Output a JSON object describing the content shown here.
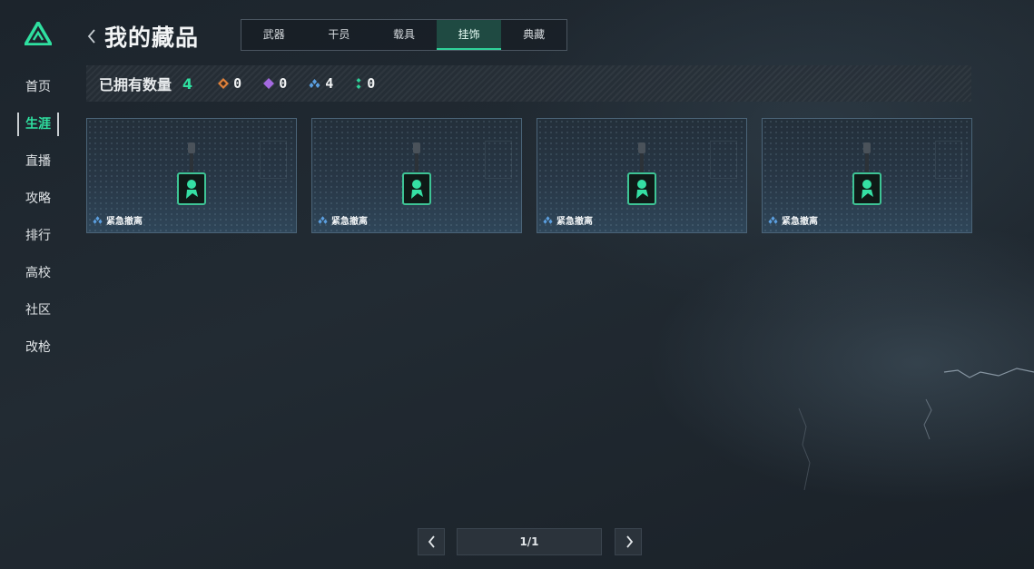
{
  "sidebar": {
    "items": [
      {
        "label": "首页"
      },
      {
        "label": "生涯"
      },
      {
        "label": "直播"
      },
      {
        "label": "攻略"
      },
      {
        "label": "排行"
      },
      {
        "label": "高校"
      },
      {
        "label": "社区"
      },
      {
        "label": "改枪"
      }
    ],
    "active_index": 1,
    "accent_color": "#2fe0a0"
  },
  "header": {
    "title": "我的藏品",
    "tabs": [
      {
        "label": "武器"
      },
      {
        "label": "干员"
      },
      {
        "label": "载具"
      },
      {
        "label": "挂饰"
      },
      {
        "label": "典藏"
      }
    ],
    "active_tab_index": 3
  },
  "stats": {
    "owned_label": "已拥有数量",
    "owned_count": "4",
    "rarity_counts": [
      {
        "icon": "orange-diamond-icon",
        "color": "#e0813a",
        "value": "0"
      },
      {
        "icon": "purple-diamond-icon",
        "color": "#a46ae0",
        "value": "0"
      },
      {
        "icon": "blue-diamond-icon",
        "color": "#5b9fe0",
        "value": "4"
      },
      {
        "icon": "green-diamond-icon",
        "color": "#2fd39a",
        "value": "0"
      }
    ]
  },
  "items": [
    {
      "name": "紧急撤离",
      "rarity_icon": "blue-diamond-icon"
    },
    {
      "name": "紧急撤离",
      "rarity_icon": "blue-diamond-icon"
    },
    {
      "name": "紧急撤离",
      "rarity_icon": "blue-diamond-icon"
    },
    {
      "name": "紧急撤离",
      "rarity_icon": "blue-diamond-icon"
    }
  ],
  "pagination": {
    "current": 1,
    "total": 1,
    "label": "1/1"
  }
}
